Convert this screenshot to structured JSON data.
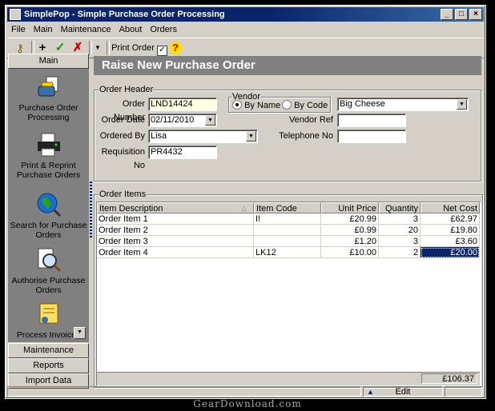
{
  "window": {
    "title": "SimplePop - Simple Purchase Order Processing"
  },
  "menu": [
    "File",
    "Main",
    "Maintenance",
    "About",
    "Orders"
  ],
  "toolbar": {
    "print_order_label": "Print Order",
    "print_order_checked": true
  },
  "sidebar": {
    "main_header": "Main",
    "items": [
      {
        "label": "Purchase Order Processing",
        "icon": "phone-order-icon"
      },
      {
        "label": "Print & Reprint Purchase Orders",
        "icon": "printer-icon"
      },
      {
        "label": "Search for Purchase Orders",
        "icon": "globe-search-icon"
      },
      {
        "label": "Authorise Purchase Orders",
        "icon": "magnifier-document-icon"
      },
      {
        "label": "Process Invoices",
        "icon": "invoice-icon"
      }
    ],
    "sections": [
      "Maintenance",
      "Reports",
      "Import Data"
    ]
  },
  "form": {
    "banner": "Raise New Purchase Order",
    "header_group": "Order Header",
    "order_number_label": "Order Number",
    "order_number": "LND14424",
    "order_date_label": "Order Date",
    "order_date": "02/11/2010",
    "ordered_by_label": "Ordered By",
    "ordered_by": "Lisa",
    "requisition_label": "Requisition No",
    "requisition_no": "PR4432",
    "vendor_group": "Vendor",
    "by_name_label": "By Name",
    "by_code_label": "By Code",
    "vendor_selected": "By Name",
    "vendor_name": "Big Cheese",
    "vendor_ref_label": "Vendor Ref",
    "vendor_ref": "",
    "telephone_label": "Telephone No",
    "telephone": ""
  },
  "items": {
    "group": "Order Items",
    "columns": [
      "Item Description",
      "Item Code",
      "Unit Price",
      "Quantity",
      "Net Cost"
    ],
    "rows": [
      [
        "Order Item 1",
        "I!",
        "£20.99",
        "3",
        "£62.97"
      ],
      [
        "Order Item 2",
        "",
        "£0.99",
        "20",
        "£19.80"
      ],
      [
        "Order Item 3",
        "",
        "£1.20",
        "3",
        "£3.60"
      ],
      [
        "Order Item 4",
        "LK12",
        "£10.00",
        "2",
        "£20.00"
      ]
    ],
    "total": "£106.37"
  },
  "status": {
    "mode": "Edit"
  },
  "watermark": "GearDownload.com",
  "colors": {
    "title_bar": "#0a246a",
    "selection": "#0a246a",
    "field_highlight": "#ffffe1"
  }
}
